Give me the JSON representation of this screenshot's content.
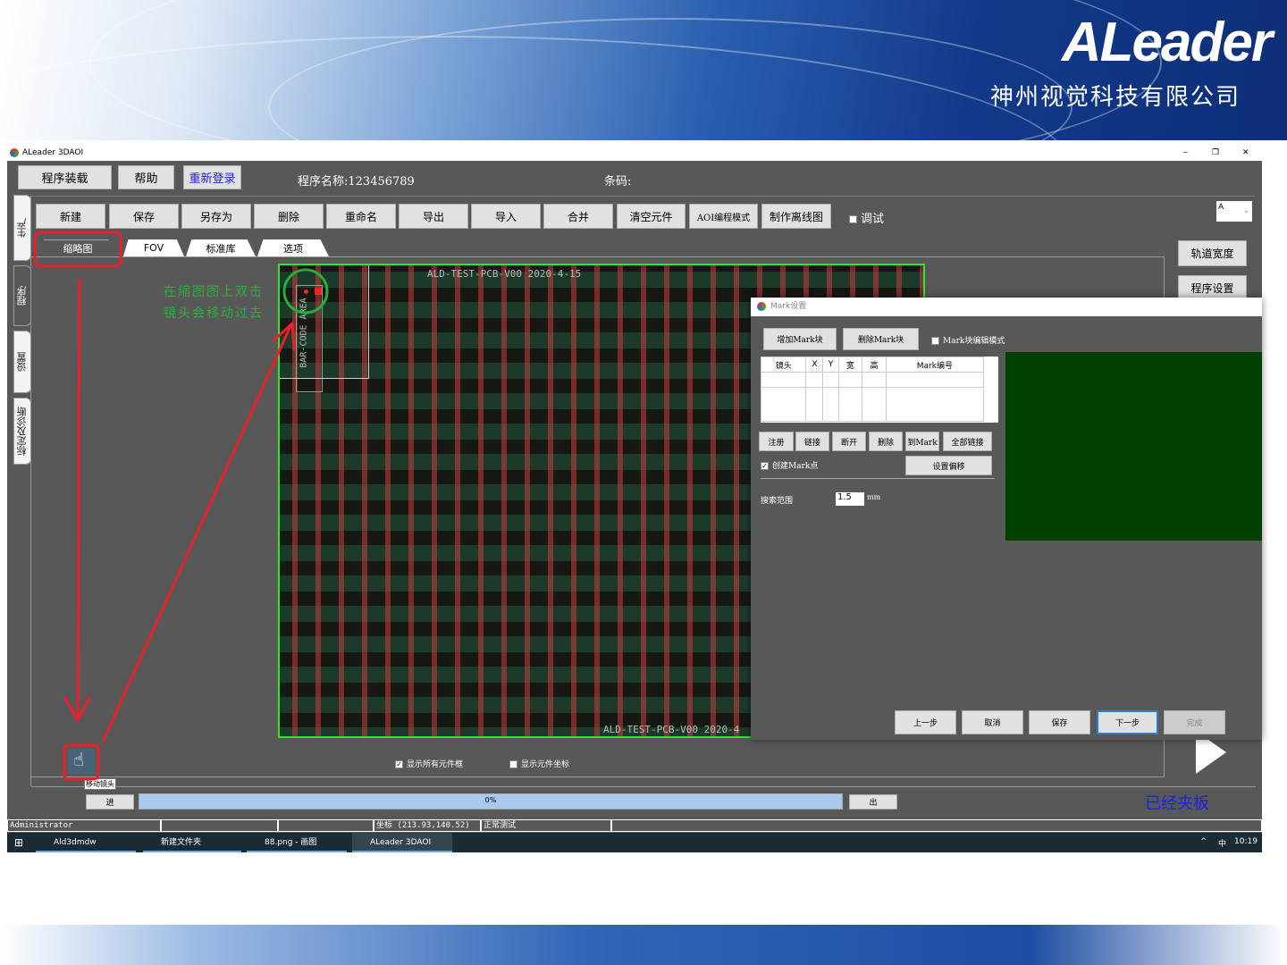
{
  "banner": {
    "logo": "ALeader",
    "company": "神州视觉科技有限公司"
  },
  "window": {
    "title": "ALeader 3DAOI",
    "minimize": "–",
    "maximize": "❐",
    "close": "✕"
  },
  "top": {
    "load": "程序装载",
    "help": "帮助",
    "relogin": "重新登录",
    "program_name": "程序名称:123456789",
    "barcode": "条码:"
  },
  "side_tabs": [
    "生产",
    "程序",
    "设置",
    "标定及诊断"
  ],
  "toolbar": [
    "新建",
    "保存",
    "另存为",
    "删除",
    "重命名",
    "导出",
    "导入",
    "合并",
    "清空元件",
    "AOI编程模式",
    "制作离线图"
  ],
  "debug_label": "调试",
  "track_select": "A",
  "right_buttons": [
    "轨道宽度",
    "程序设置"
  ],
  "tabs": [
    "缩略图",
    "FOV",
    "标准库",
    "选项"
  ],
  "pcb": {
    "title": "ALD-TEST-PCB-V00  2020-4-15",
    "barcode": "BAR-CODE AREA",
    "bottom": "ALD-TEST-PCB-V00  2020-4"
  },
  "annotation": {
    "line1": "在缩图图上双击",
    "line2": "镜头会移动过去"
  },
  "tools": {
    "tooltip": "移动镜头"
  },
  "view_options": {
    "show_all_boxes": "显示所有元件框",
    "show_coords": "显示元件坐标"
  },
  "progress": {
    "in": "进",
    "value": "0%",
    "percent": 0,
    "out": "出"
  },
  "clamp_status": "已经夹板",
  "statusbar": {
    "user": "Administrator",
    "coord": "坐标 (213.93,140.52)",
    "mode": "正常测试"
  },
  "dialog": {
    "title": "Mark设置",
    "add": "增加Mark块",
    "del": "删除Mark块",
    "edit_mode": "Mark块编辑模式",
    "columns": [
      "镜头",
      "X",
      "Y",
      "宽",
      "高",
      "Mark编号"
    ],
    "actions": [
      "注册",
      "链接",
      "断开",
      "删除",
      "到Mark",
      "全部链接"
    ],
    "create_mark": "创建Mark点",
    "set_offset": "设置偏移",
    "search_label": "搜索范围",
    "search_value": "1.5",
    "unit": "mm",
    "footer": [
      "上一步",
      "取消",
      "保存",
      "下一步",
      "完成"
    ]
  },
  "taskbar": {
    "items": [
      "Ald3dmdw",
      "新建文件夹",
      "88.png - 画图",
      "ALeader 3DAOI"
    ],
    "tray_up": "^",
    "ime": "中",
    "time": "10:19"
  }
}
